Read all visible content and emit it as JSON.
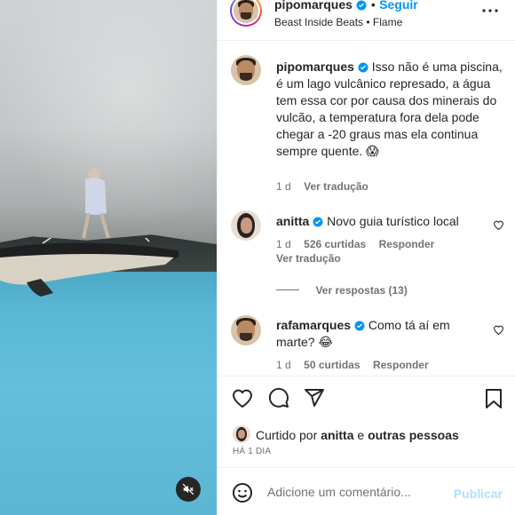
{
  "header": {
    "username": "pipomarques",
    "dot": "•",
    "follow_label": "Seguir",
    "audio": "Beast Inside Beats • Flame",
    "more_icon": "more-horizontal-icon"
  },
  "caption": {
    "username": "pipomarques",
    "text": "Isso não é uma piscina, é um lago vulcânico represado, a água tem essa cor por causa dos minerais do vulcão, a temperatura fora dela pode chegar a -20 graus mas ela continua sempre quente. 😱",
    "time": "1 d",
    "translate": "Ver tradução"
  },
  "comments": [
    {
      "username": "anitta",
      "text": "Novo guia turístico local",
      "time": "1 d",
      "likes": "526 curtidas",
      "reply": "Responder",
      "translate": "Ver tradução",
      "view_replies": "Ver respostas (13)"
    },
    {
      "username": "rafamarques",
      "text": "Como tá aí em marte? 😂",
      "time": "1 d",
      "likes": "50 curtidas",
      "reply": "Responder"
    }
  ],
  "liked_by": {
    "prefix": "Curtido por",
    "user": "anitta",
    "and": "e",
    "others": "outras pessoas"
  },
  "timestamp": "HÁ 1 DIA",
  "composer": {
    "placeholder": "Adicione um comentário...",
    "publish": "Publicar"
  },
  "colors": {
    "accent": "#0095f6",
    "publish_disabled": "#b2dffc",
    "verified": "#0095f6"
  }
}
